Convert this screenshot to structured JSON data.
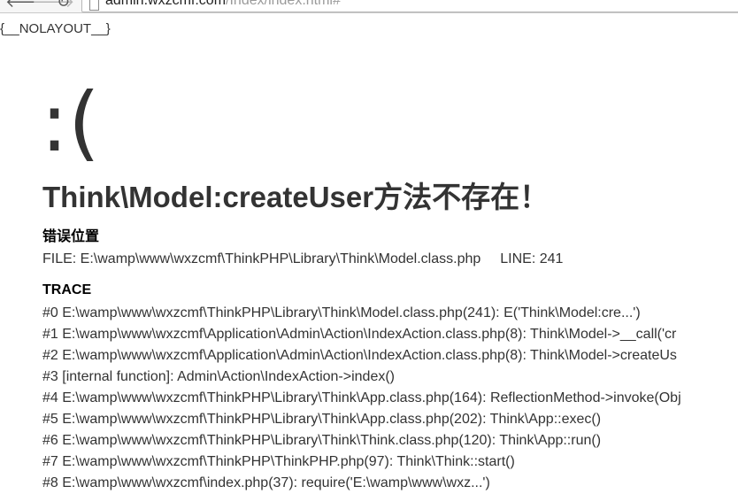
{
  "browser": {
    "back_icon": "🡐",
    "forward_icon": "🡒",
    "reload_icon": "↻",
    "url_host": "admin.wxzcmf.com",
    "url_path": "/Index/index.html#"
  },
  "page": {
    "nolayout": "{__NOLAYOUT__}",
    "face": ":(",
    "error_message": "Think\\Model:createUser方法不存在！",
    "location_title": "错误位置",
    "file_label": "FILE: E:\\wamp\\www\\wxzcmf\\ThinkPHP\\Library\\Think\\Model.class.php",
    "line_label": "LINE: 241",
    "trace_title": "TRACE",
    "trace": [
      "#0 E:\\wamp\\www\\wxzcmf\\ThinkPHP\\Library\\Think\\Model.class.php(241): E('Think\\Model:cre...')",
      "#1 E:\\wamp\\www\\wxzcmf\\Application\\Admin\\Action\\IndexAction.class.php(8): Think\\Model->__call('cr",
      "#2 E:\\wamp\\www\\wxzcmf\\Application\\Admin\\Action\\IndexAction.class.php(8): Think\\Model->createUs",
      "#3 [internal function]: Admin\\Action\\IndexAction->index()",
      "#4 E:\\wamp\\www\\wxzcmf\\ThinkPHP\\Library\\Think\\App.class.php(164): ReflectionMethod->invoke(Obj",
      "#5 E:\\wamp\\www\\wxzcmf\\ThinkPHP\\Library\\Think\\App.class.php(202): Think\\App::exec()",
      "#6 E:\\wamp\\www\\wxzcmf\\ThinkPHP\\Library\\Think\\Think.class.php(120): Think\\App::run()",
      "#7 E:\\wamp\\www\\wxzcmf\\ThinkPHP\\ThinkPHP.php(97): Think\\Think::start()",
      "#8 E:\\wamp\\www\\wxzcmf\\index.php(37): require('E:\\wamp\\www\\wxz...')"
    ]
  }
}
